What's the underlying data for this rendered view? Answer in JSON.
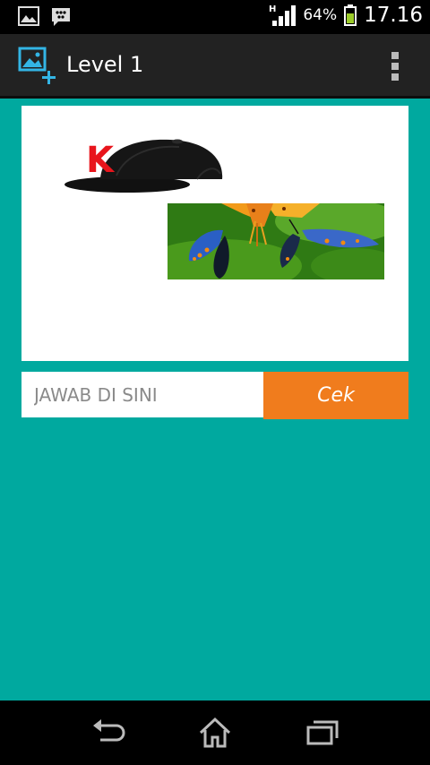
{
  "status_bar": {
    "network": "H",
    "battery_percent": "64%",
    "time": "17.16",
    "icons": [
      "gallery-notification-icon",
      "bbm-notification-icon",
      "signal-icon",
      "battery-icon"
    ]
  },
  "action_bar": {
    "title": "Level 1",
    "icons": [
      "add-image-icon",
      "overflow-menu-icon"
    ]
  },
  "puzzle": {
    "letter": "K",
    "images": [
      "cap-image",
      "butterflies-image"
    ]
  },
  "answer": {
    "placeholder": "JAWAB DI SINI",
    "value": "",
    "check_label": "Cek"
  },
  "nav_bar": {
    "icons": [
      "back-icon",
      "home-icon",
      "recent-apps-icon"
    ]
  },
  "colors": {
    "background": "#00a99f",
    "action_bar": "#222222",
    "check_button": "#f07c1d",
    "icon_accent": "#33b5e5"
  }
}
